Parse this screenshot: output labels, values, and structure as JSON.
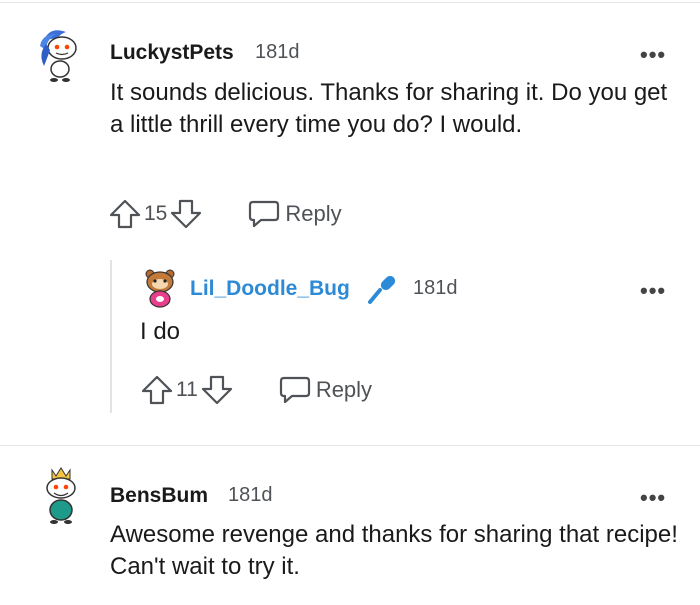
{
  "comments": [
    {
      "username": "LuckystPets",
      "age": "181d",
      "text": "It sounds delicious. Thanks for sharing it. Do you get a little thrill every time you do? I would.",
      "score": "15",
      "reply_label": "Reply",
      "more_label": "•••"
    },
    {
      "username": "Lil_Doodle_Bug",
      "age": "181d",
      "text": "I do",
      "score": "11",
      "reply_label": "Reply",
      "more_label": "•••",
      "badge_icon": "microphone-icon"
    },
    {
      "username": "BensBum",
      "age": "181d",
      "text": "Awesome revenge and thanks for sharing that recipe! Can't wait to try it.",
      "more_label": "•••"
    }
  ],
  "colors": {
    "op_username": "#2c8ad6",
    "meta_gray": "#4f5256",
    "divider": "#e6e6e6"
  }
}
